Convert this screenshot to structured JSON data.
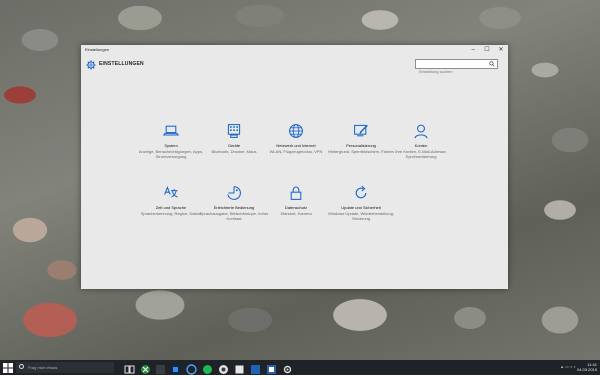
{
  "window": {
    "title": "Einstellungen",
    "minimize": "–",
    "maximize": "☐",
    "close": "✕"
  },
  "header": {
    "heading": "EINSTELLUNGEN",
    "search_placeholder": "Einstellung suchen"
  },
  "categories": [
    {
      "icon": "laptop-icon",
      "title": "System",
      "desc": "Anzeige, Benachrichtigungen, Apps, Stromversorgung"
    },
    {
      "icon": "keyboard-icon",
      "title": "Geräte",
      "desc": "Bluetooth, Drucker, Maus"
    },
    {
      "icon": "globe-icon",
      "title": "Netzwerk und Internet",
      "desc": "WLAN, Flugzeugmodus, VPN"
    },
    {
      "icon": "paintbrush-icon",
      "title": "Personalisierung",
      "desc": "Hintergrund, Sperrbildschirm, Farben"
    },
    {
      "icon": "person-icon",
      "title": "Konten",
      "desc": "Ihre Konten, E-Mail-Adresse, Synchronisierung"
    },
    {
      "icon": "language-icon",
      "title": "Zeit und Sprache",
      "desc": "Spracherkennung, Region, Datum"
    },
    {
      "icon": "ease-of-access-icon",
      "title": "Erleichterte Bedienung",
      "desc": "Sprachausgabe, Bildschirmlupe, hoher Kontrast"
    },
    {
      "icon": "lock-icon",
      "title": "Datenschutz",
      "desc": "Standort, Kamera"
    },
    {
      "icon": "refresh-icon",
      "title": "Update und Sicherheit",
      "desc": "Windows Update, Wiederherstellung, Sicherung"
    }
  ],
  "taskbar": {
    "search_placeholder": "Frag mich etwas",
    "clock_time": "11:41",
    "clock_date": "04.03.2015"
  },
  "colors": {
    "accent": "#1a66c9"
  }
}
